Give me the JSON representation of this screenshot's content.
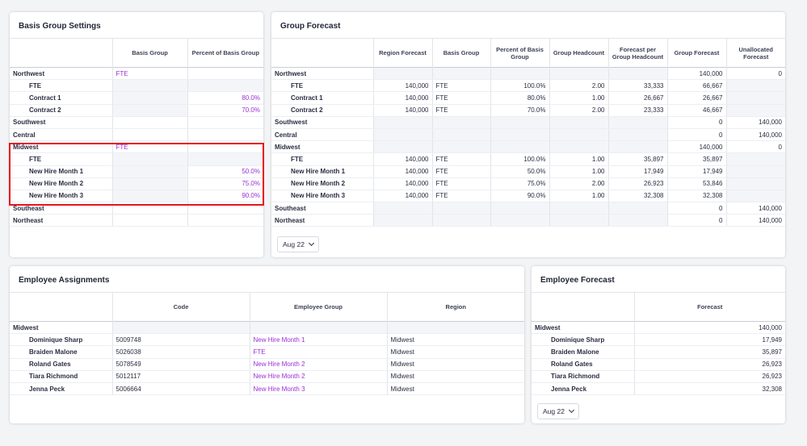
{
  "basis_settings": {
    "title": "Basis Group Settings",
    "headers": [
      "",
      "Basis Group",
      "Percent of Basis Group"
    ],
    "rows": [
      {
        "label": "Northwest",
        "basis": "FTE",
        "pct": "",
        "indent": false
      },
      {
        "label": "FTE",
        "basis": "",
        "pct": "",
        "indent": true
      },
      {
        "label": "Contract 1",
        "basis": "",
        "pct": "80.0%",
        "indent": true
      },
      {
        "label": "Contract 2",
        "basis": "",
        "pct": "70.0%",
        "indent": true
      },
      {
        "label": "Southwest",
        "basis": "",
        "pct": "",
        "indent": false
      },
      {
        "label": "Central",
        "basis": "",
        "pct": "",
        "indent": false
      },
      {
        "label": "Midwest",
        "basis": "FTE",
        "pct": "",
        "indent": false
      },
      {
        "label": "FTE",
        "basis": "",
        "pct": "",
        "indent": true
      },
      {
        "label": "New Hire Month 1",
        "basis": "",
        "pct": "50.0%",
        "indent": true
      },
      {
        "label": "New Hire Month 2",
        "basis": "",
        "pct": "75.0%",
        "indent": true
      },
      {
        "label": "New Hire Month 3",
        "basis": "",
        "pct": "90.0%",
        "indent": true
      },
      {
        "label": "Southeast",
        "basis": "",
        "pct": "",
        "indent": false
      },
      {
        "label": "Northeast",
        "basis": "",
        "pct": "",
        "indent": false
      }
    ]
  },
  "group_forecast": {
    "title": "Group Forecast",
    "headers": [
      "",
      "Region Forecast",
      "Basis Group",
      "Percent of Basis Group",
      "Group Headcount",
      "Forecast per Group Headcount",
      "Group Forecast",
      "Unallocated Forecast"
    ],
    "rows": [
      {
        "label": "Northwest",
        "indent": false,
        "cells": [
          "",
          "",
          "",
          "",
          "",
          "140,000",
          "0"
        ]
      },
      {
        "label": "FTE",
        "indent": true,
        "cells": [
          "140,000",
          "FTE",
          "100.0%",
          "2.00",
          "33,333",
          "66,667",
          ""
        ]
      },
      {
        "label": "Contract 1",
        "indent": true,
        "cells": [
          "140,000",
          "FTE",
          "80.0%",
          "1.00",
          "26,667",
          "26,667",
          ""
        ]
      },
      {
        "label": "Contract 2",
        "indent": true,
        "cells": [
          "140,000",
          "FTE",
          "70.0%",
          "2.00",
          "23,333",
          "46,667",
          ""
        ]
      },
      {
        "label": "Southwest",
        "indent": false,
        "cells": [
          "",
          "",
          "",
          "",
          "",
          "0",
          "140,000"
        ]
      },
      {
        "label": "Central",
        "indent": false,
        "cells": [
          "",
          "",
          "",
          "",
          "",
          "0",
          "140,000"
        ]
      },
      {
        "label": "Midwest",
        "indent": false,
        "cells": [
          "",
          "",
          "",
          "",
          "",
          "140,000",
          "0"
        ]
      },
      {
        "label": "FTE",
        "indent": true,
        "cells": [
          "140,000",
          "FTE",
          "100.0%",
          "1.00",
          "35,897",
          "35,897",
          ""
        ]
      },
      {
        "label": "New Hire Month 1",
        "indent": true,
        "cells": [
          "140,000",
          "FTE",
          "50.0%",
          "1.00",
          "17,949",
          "17,949",
          ""
        ]
      },
      {
        "label": "New Hire Month 2",
        "indent": true,
        "cells": [
          "140,000",
          "FTE",
          "75.0%",
          "2.00",
          "26,923",
          "53,846",
          ""
        ]
      },
      {
        "label": "New Hire Month 3",
        "indent": true,
        "cells": [
          "140,000",
          "FTE",
          "90.0%",
          "1.00",
          "32,308",
          "32,308",
          ""
        ]
      },
      {
        "label": "Southeast",
        "indent": false,
        "cells": [
          "",
          "",
          "",
          "",
          "",
          "0",
          "140,000"
        ]
      },
      {
        "label": "Northeast",
        "indent": false,
        "cells": [
          "",
          "",
          "",
          "",
          "",
          "0",
          "140,000"
        ]
      }
    ],
    "period": "Aug 22"
  },
  "employee_assignments": {
    "title": "Employee Assignments",
    "headers": [
      "",
      "Code",
      "Employee Group",
      "Region"
    ],
    "rows": [
      {
        "label": "Midwest",
        "indent": false,
        "code": "",
        "group": "",
        "region": ""
      },
      {
        "label": "Dominique Sharp",
        "indent": true,
        "code": "5009748",
        "group": "New Hire Month 1",
        "region": "Midwest"
      },
      {
        "label": "Braiden Malone",
        "indent": true,
        "code": "5026038",
        "group": "FTE",
        "region": "Midwest"
      },
      {
        "label": "Roland Gates",
        "indent": true,
        "code": "5078549",
        "group": "New Hire Month 2",
        "region": "Midwest"
      },
      {
        "label": "Tiara Richmond",
        "indent": true,
        "code": "5012117",
        "group": "New Hire Month 2",
        "region": "Midwest"
      },
      {
        "label": "Jenna Peck",
        "indent": true,
        "code": "5006664",
        "group": "New Hire Month 3",
        "region": "Midwest"
      }
    ]
  },
  "employee_forecast": {
    "title": "Employee Forecast",
    "headers": [
      "",
      "Forecast"
    ],
    "rows": [
      {
        "label": "Midwest",
        "indent": false,
        "value": "140,000"
      },
      {
        "label": "Dominique Sharp",
        "indent": true,
        "value": "17,949"
      },
      {
        "label": "Braiden Malone",
        "indent": true,
        "value": "35,897"
      },
      {
        "label": "Roland Gates",
        "indent": true,
        "value": "26,923"
      },
      {
        "label": "Tiara Richmond",
        "indent": true,
        "value": "26,923"
      },
      {
        "label": "Jenna Peck",
        "indent": true,
        "value": "32,308"
      }
    ],
    "period": "Aug 22"
  },
  "colors": {
    "accent": "#9b2fd6",
    "highlight": "#e8141b"
  }
}
